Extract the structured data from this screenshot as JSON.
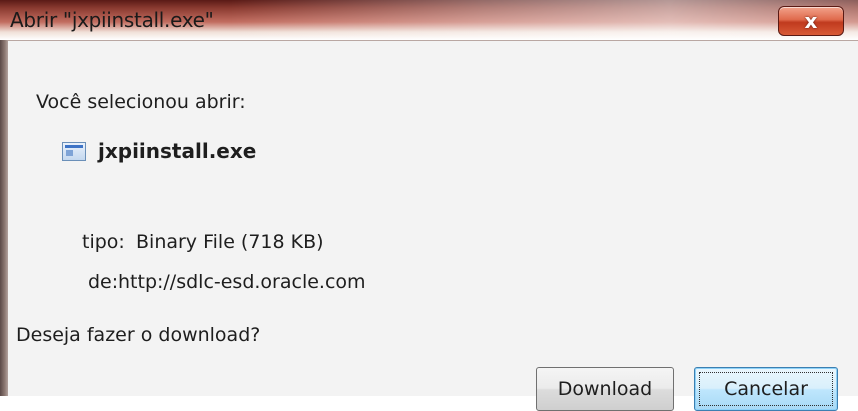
{
  "window": {
    "title": "Abrir \"jxpiinstall.exe\"",
    "close_glyph": "x"
  },
  "dialog": {
    "prompt": "Você selecionou abrir:",
    "file_icon": "executable-file-icon",
    "file_name": "jxpiinstall.exe",
    "type_label": "tipo:",
    "type_value": "Binary File (718 KB)",
    "from_label": "de:",
    "from_value": "http://sdlc-esd.oracle.com",
    "question": "Deseja fazer o download?"
  },
  "buttons": {
    "download_label": "Download",
    "cancel_label": "Cancelar"
  },
  "colors": {
    "titlebar_accent": "#8a3a30",
    "close_button": "#c03a1e",
    "focused_button": "#bee6fd"
  }
}
